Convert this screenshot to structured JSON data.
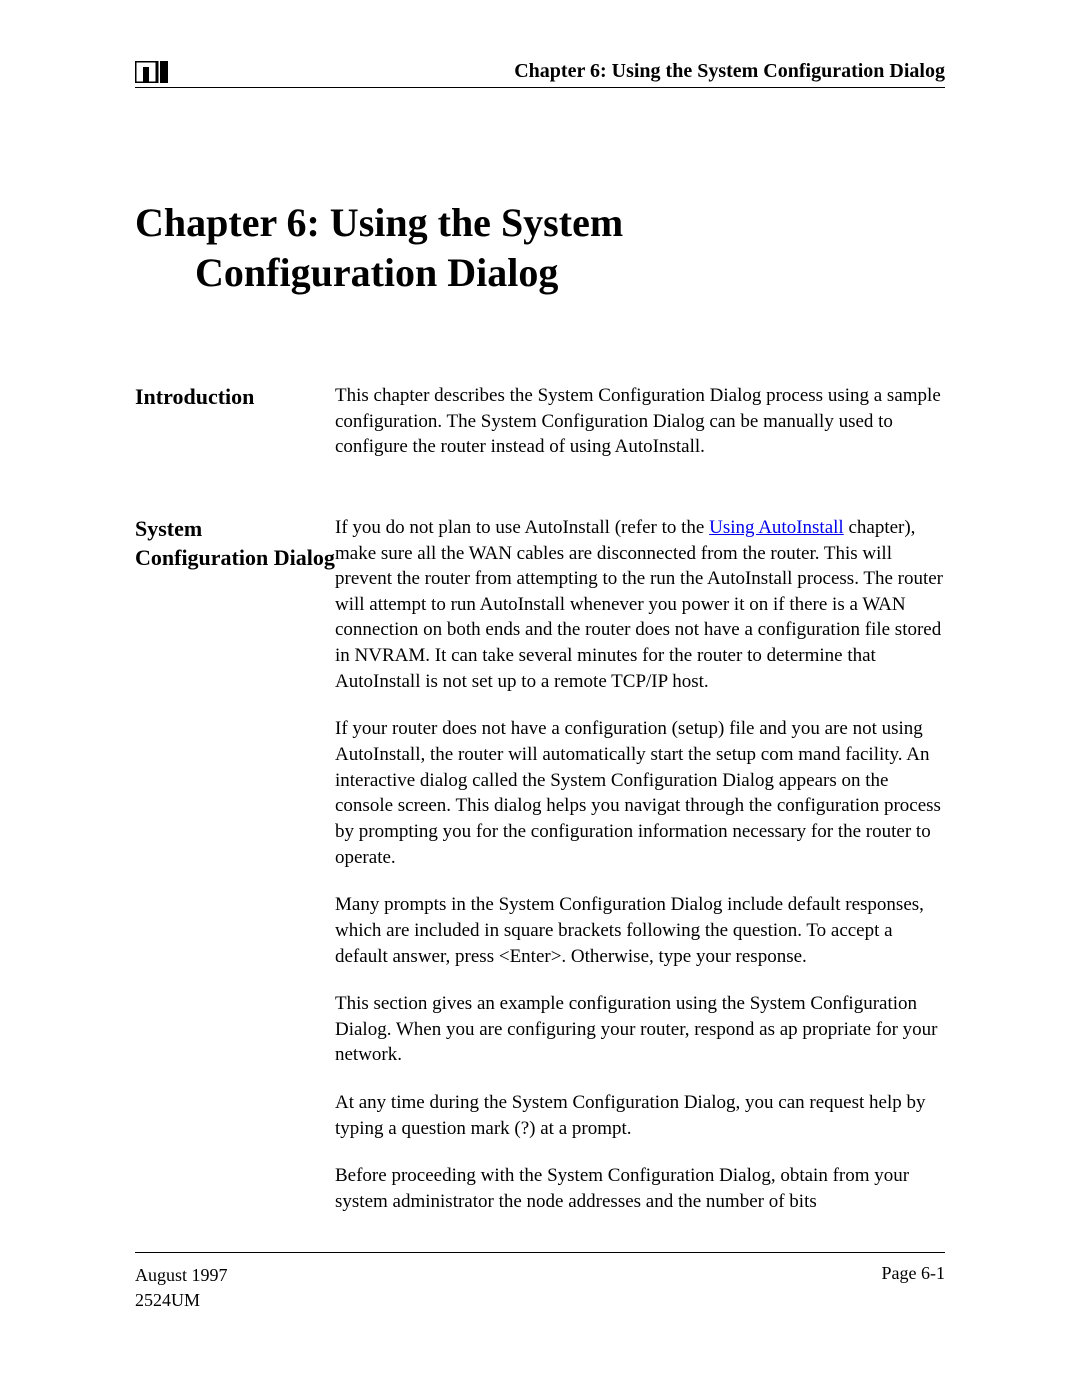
{
  "header": {
    "title": "Chapter 6: Using the System Configuration Dialog"
  },
  "chapter": {
    "title_line1": "Chapter 6: Using the System",
    "title_line2": "Configuration Dialog"
  },
  "sections": {
    "introduction": {
      "heading": "Introduction",
      "paragraph1": "This chapter describes the System Configuration Dialog process using a sample configuration.  The System Configuration Dialog can be manually used to configure the router instead of using AutoInstall."
    },
    "scd": {
      "heading": "System Configuration Dialog",
      "p1_prefix": "If you do not plan to use AutoInstall (refer to the ",
      "p1_link": "Using AutoInstall",
      "p1_suffix": " chapter), make sure all the WAN cables are disconnected from the router. This will prevent the router from attempting to the run the AutoInstall process. The router will attempt to run AutoInstall whenever you power it on if there is a WAN connection on both ends and the router does not have a configuration file stored in NVRAM. It can take several minutes for the router to determine that AutoInstall is not set up to a remote TCP/IP host.",
      "p2": "If your router does not have a configuration (setup) file and you are not using AutoInstall, the router will automatically start the setup com mand facility. An interactive dialog called the System Configuration Dialog appears on the console screen. This dialog helps you navigat through the configuration process by prompting you for the configuration information necessary for the router to operate.",
      "p3": "Many prompts in the System Configuration Dialog include default responses, which are included in square brackets following the question. To accept a default answer, press <Enter>. Otherwise, type your response.",
      "p4": "This section gives an example configuration using the System Configuration Dialog. When you are configuring your router, respond as ap propriate for your network.",
      "p5": "At any time during the System Configuration Dialog, you can request help by typing a question mark (?) at a prompt.",
      "p6": "Before proceeding with the System Configuration Dialog, obtain from your system administrator the node addresses and the number of bits"
    }
  },
  "footer": {
    "date": "August 1997",
    "docnum": "2524UM",
    "page": "Page 6-1"
  }
}
